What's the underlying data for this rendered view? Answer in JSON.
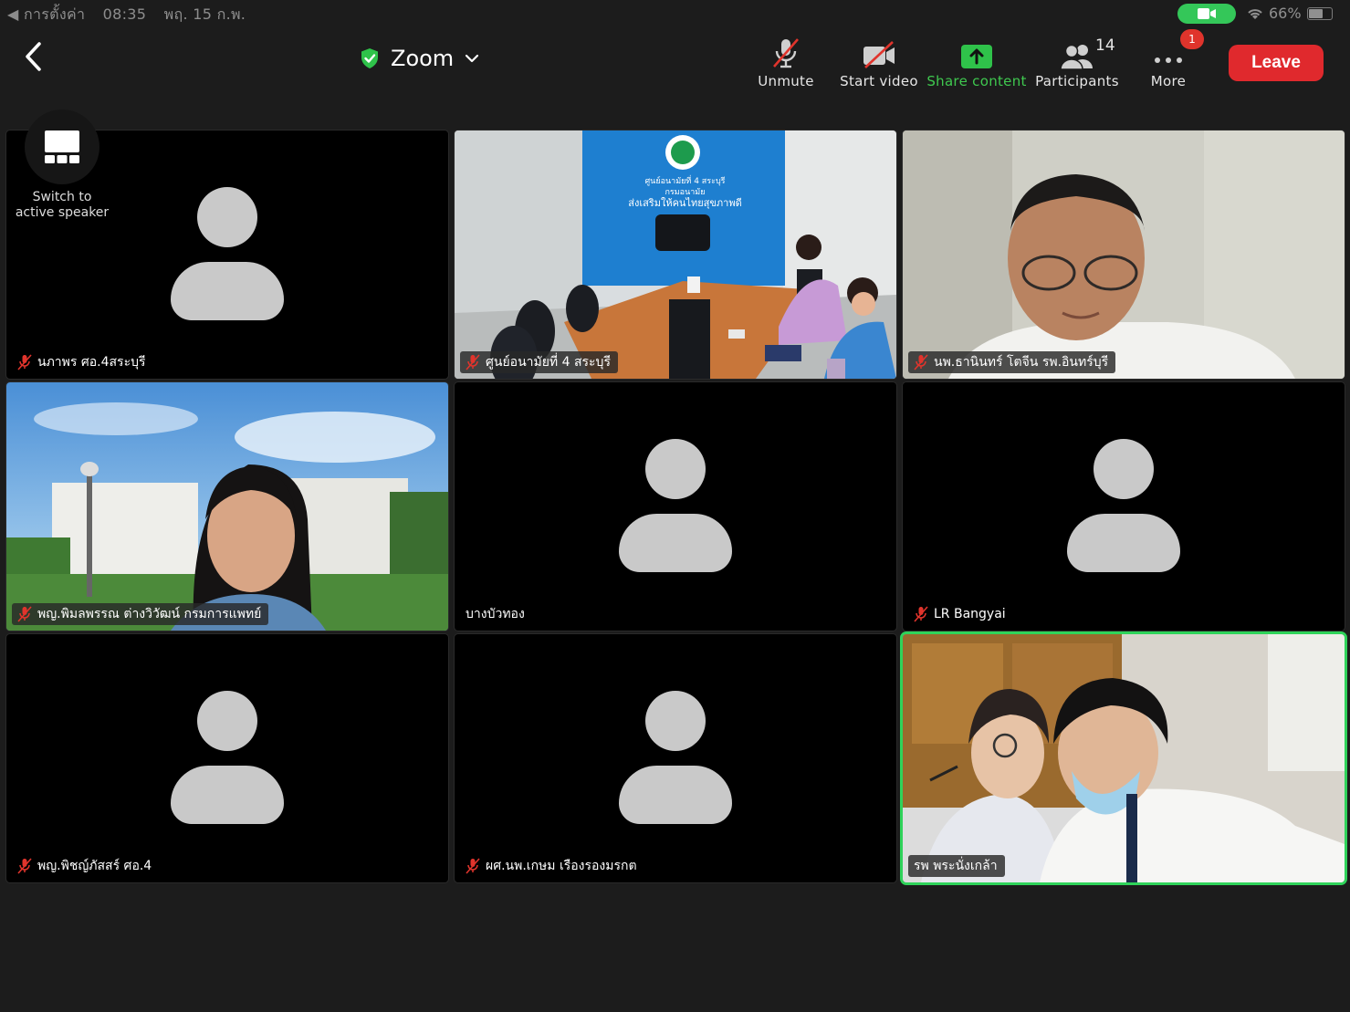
{
  "status_bar": {
    "back_app": "◀ การตั้งค่า",
    "time": "08:35",
    "date": "พฤ. 15 ก.พ.",
    "battery": "66%"
  },
  "header": {
    "title": "Zoom",
    "security_icon": "shield-check-icon",
    "accent_green": "#2fd35a",
    "leave_color": "#e0292d"
  },
  "toolbar": {
    "unmute": "Unmute",
    "start_video": "Start video",
    "share_content": "Share content",
    "participants": "Participants",
    "participants_count": "14",
    "more": "More",
    "more_badge": "1",
    "leave": "Leave"
  },
  "switch_speaker": {
    "label_line1": "Switch to",
    "label_line2": "active speaker"
  },
  "participants": [
    {
      "name": "นภาพร ศอ.4สระบุรี",
      "muted": true,
      "video": false
    },
    {
      "name": "ศูนย์อนามัยที่ 4 สระบุรี",
      "muted": true,
      "video": true
    },
    {
      "name": "นพ.ธานินทร์ โตจีน รพ.อินทร์บุรี",
      "muted": true,
      "video": true
    },
    {
      "name": "พญ.พิมลพรรณ ต่างวิวัฒน์ กรมการแพทย์",
      "muted": true,
      "video": true
    },
    {
      "name": "บางบัวทอง",
      "muted": false,
      "video": false
    },
    {
      "name": "LR Bangyai",
      "muted": true,
      "video": false
    },
    {
      "name": "พญ.พิชญ์ภัสสร์ ศอ.4",
      "muted": true,
      "video": false
    },
    {
      "name": "ผศ.นพ.เกษม เรืองรองมรกต",
      "muted": true,
      "video": false
    },
    {
      "name": "รพ พระนั่งเกล้า",
      "muted": false,
      "video": true,
      "active": true
    }
  ],
  "banner_text": {
    "line1": "ศูนย์อนามัยที่ 4 สระบุรี",
    "line2": "กรมอนามัย",
    "line3": "ส่งเสริมให้คนไทยสุขภาพดี"
  }
}
